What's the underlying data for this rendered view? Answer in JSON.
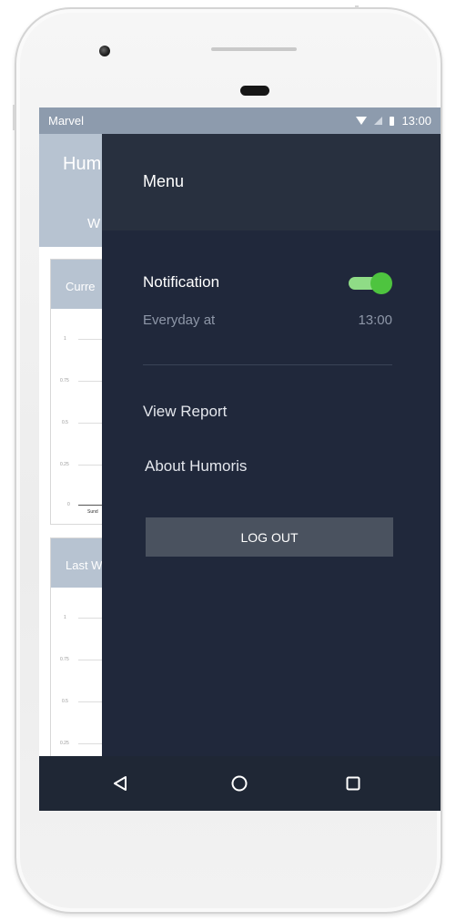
{
  "status_bar": {
    "carrier": "Marvel",
    "time": "13:00",
    "icons": [
      "wifi-icon",
      "signal-icon",
      "battery-icon"
    ]
  },
  "background_screen": {
    "title": "Hum",
    "tab": "W",
    "cards": [
      {
        "header": "Curre",
        "y_ticks": [
          "1",
          "0.75",
          "0.5",
          "0.25",
          "0"
        ],
        "x_label": "Sund"
      },
      {
        "header": "Last W",
        "y_ticks": [
          "1",
          "0.75",
          "0.5",
          "0.25"
        ]
      }
    ]
  },
  "drawer": {
    "title": "Menu",
    "notification": {
      "label": "Notification",
      "enabled": true,
      "schedule_label": "Everyday at",
      "schedule_time": "13:00"
    },
    "items": [
      {
        "label": "View Report"
      },
      {
        "label": "About Humoris"
      }
    ],
    "logout_label": "LOG OUT"
  },
  "nav_bar": {
    "buttons": [
      "back-icon",
      "home-icon",
      "recents-icon"
    ]
  },
  "colors": {
    "drawer_bg": "#20283b",
    "drawer_header_bg": "#28303f",
    "toggle_on": "#4ec43f",
    "logout_button_bg": "#4a525f",
    "status_bar_bg": "#8d9bad",
    "app_header_bg": "#b7c3d1"
  }
}
